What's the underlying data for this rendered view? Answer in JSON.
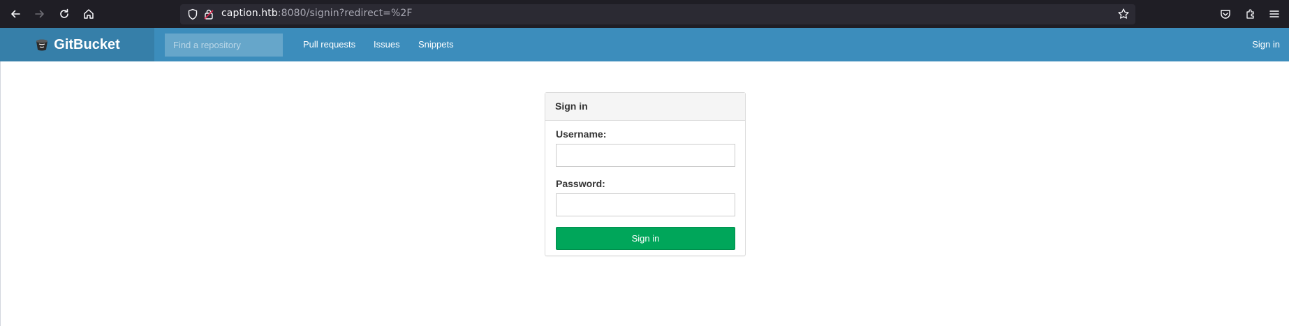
{
  "browser": {
    "url_host": "caption.htb",
    "url_rest": ":8080/signin?redirect=%2F",
    "icons": [
      "back-arrow-icon",
      "forward-arrow-icon",
      "reload-icon",
      "home-icon",
      "shield-icon",
      "lock-icon",
      "star-icon",
      "pocket-icon",
      "extensions-icon",
      "menu-icon"
    ]
  },
  "header": {
    "brand": "GitBucket",
    "search_placeholder": "Find a repository",
    "nav": [
      "Pull requests",
      "Issues",
      "Snippets"
    ],
    "signin": "Sign in",
    "colors": {
      "header": "#3c8dbc",
      "brand_bg": "#367fa9"
    }
  },
  "signin_form": {
    "title": "Sign in",
    "username_label": "Username:",
    "password_label": "Password:",
    "username_value": "",
    "password_value": "",
    "submit_label": "Sign in",
    "colors": {
      "submit": "#00a65a"
    }
  }
}
